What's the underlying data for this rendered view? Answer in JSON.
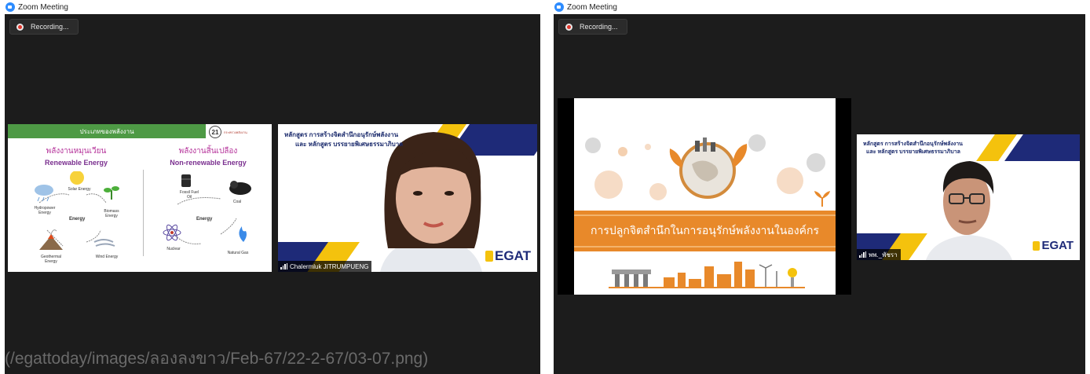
{
  "left_window": {
    "title": "Zoom Meeting",
    "recording_label": "Recording...",
    "slide": {
      "header": "ประเภทของพลังงาน",
      "logo_text": "กระทรวงพลังงาน",
      "renewable": {
        "thai": "พลังงานหมุนเวียน",
        "english": "Renewable Energy",
        "icons": {
          "solar": "Solar Energy",
          "hydro": "Hydropower Energy",
          "biomass": "Biomass Energy",
          "center": "Energy",
          "geothermal": "Geothermal Energy",
          "wind": "Wind Energy"
        }
      },
      "nonrenewable": {
        "thai": "พลังงานสิ้นเปลือง",
        "english": "Non-renewable Energy",
        "icons": {
          "fossil": "Fossil Fuel Oil",
          "coal": "Coal",
          "center": "Energy",
          "nuclear": "Nuclear",
          "gas": "Natural Gas"
        }
      }
    },
    "video": {
      "course_line1": "หลักสูตร การสร้างจิตสำนึกอนุรักษ์พลังงาน",
      "course_line2": "และ หลักสูตร บรรยายพิเศษธรรมาภิบาล",
      "logo": "EGAT",
      "participant_name": "Chalermluk JITRUMPUENG"
    },
    "caption": "(/egattoday/images/ลองลงขาว/Feb-67/22-2-67/03-07.png)"
  },
  "right_window": {
    "title": "Zoom Meeting",
    "recording_label": "Recording...",
    "slide": {
      "title": "การปลูกจิตสำนึกในการอนุรักษ์พลังงานในองค์กร"
    },
    "video": {
      "course_line1": "หลักสูตร การสร้างจิตสำนึกอนุรักษ์พลังงาน",
      "course_line2": "และ หลักสูตร บรรยายพิเศษธรรมาภิบาล",
      "logo": "EGAT",
      "participant_name": "พพ._พัชรา"
    }
  }
}
